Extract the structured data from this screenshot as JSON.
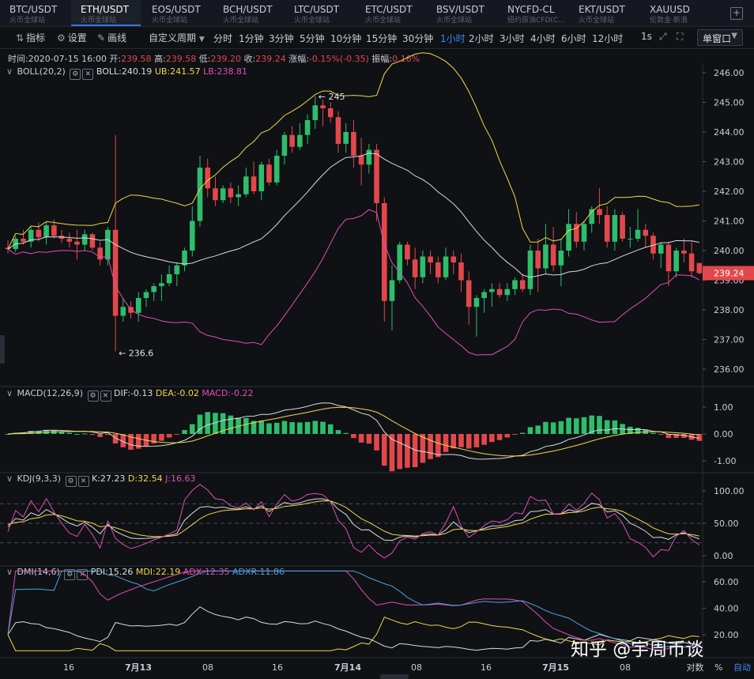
{
  "tabs": [
    {
      "symbol": "BTC/USDT",
      "source": "火币全球站",
      "active": false
    },
    {
      "symbol": "ETH/USDT",
      "source": "火币全球站",
      "active": true
    },
    {
      "symbol": "EOS/USDT",
      "source": "火币全球站",
      "active": false
    },
    {
      "symbol": "BCH/USDT",
      "source": "火币全球站",
      "active": false
    },
    {
      "symbol": "LTC/USDT",
      "source": "火币全球站",
      "active": false
    },
    {
      "symbol": "ETC/USDT",
      "source": "火币全球站",
      "active": false
    },
    {
      "symbol": "BSV/USDT",
      "source": "火币全球站",
      "active": false
    },
    {
      "symbol": "NYCFD-CL",
      "source": "纽约原油CFD(C...",
      "active": false
    },
    {
      "symbol": "EKT/USDT",
      "source": "火币全球站",
      "active": false
    },
    {
      "symbol": "XAUUSD",
      "source": "伦敦金·新浪",
      "active": false
    }
  ],
  "toolbar": {
    "indicators": "指标",
    "settings": "设置",
    "draw": "画线",
    "custom_period": "自定义周期",
    "periods": [
      "分时",
      "1分钟",
      "3分钟",
      "5分钟",
      "10分钟",
      "15分钟",
      "30分钟",
      "1小时",
      "2小时",
      "3小时",
      "4小时",
      "6小时",
      "12小时"
    ],
    "active_period": "1小时",
    "interval": "1s",
    "window_mode": "单窗口"
  },
  "info": {
    "time_label": "时间:",
    "time": "2020-07-15 16:00",
    "open_label": "开:",
    "open": "239.58",
    "high_label": "高:",
    "high": "239.58",
    "low_label": "低:",
    "low": "239.20",
    "close_label": "收:",
    "close": "239.24",
    "change_label": "涨幅:",
    "change": "-0.15%(-0.35)",
    "amp_label": "振幅:",
    "amp": "0.16%"
  },
  "boll": {
    "title": "BOLL(20,2)",
    "mid": "BOLL:240.19",
    "ub": "UB:241.57",
    "lb": "LB:238.81",
    "max_label": "245",
    "min_label": "236.6",
    "y_ticks": [
      "246.00",
      "245.00",
      "244.00",
      "243.00",
      "242.00",
      "241.00",
      "240.00",
      "239.00",
      "238.00",
      "237.00",
      "236.00"
    ],
    "price_tag": "239.24"
  },
  "macd": {
    "title": "MACD(12,26,9)",
    "dif": "DIF:-0.13",
    "dea": "DEA:-0.02",
    "macd": "MACD:-0.22",
    "y_ticks": [
      "1.00",
      "0.00",
      "-1.00"
    ]
  },
  "kdj": {
    "title": "KDJ(9,3,3)",
    "k": "K:27.23",
    "d": "D:32.54",
    "j": "J:16.63",
    "y_ticks": [
      "100.00",
      "50.00",
      "0.00"
    ]
  },
  "dmi": {
    "title": "DMI(14,6)",
    "pdi": "PDI:15.26",
    "mdi": "MDI:22.19",
    "adx": "ADX:12.35",
    "adxr": "ADXR:11.86",
    "y_ticks": [
      "60.00",
      "40.00",
      "20.00"
    ]
  },
  "x_axis": [
    "16",
    "7月13",
    "08",
    "16",
    "7月14",
    "08",
    "16",
    "7月15",
    "08"
  ],
  "bottom": {
    "log": "对数",
    "percent": "%",
    "auto": "自动"
  },
  "watermark": "知乎 @宇周币谈",
  "colors": {
    "up": "#2ebd6b",
    "down": "#e2484b",
    "ub": "#f2d84a",
    "mid": "#d9dbdf",
    "lb": "#e04fb4",
    "accent": "#3d8af7",
    "adx": "#4aa3df"
  },
  "chart_data": {
    "type": "candlestick",
    "interval": "1h",
    "candles": [
      [
        240.1,
        240.35,
        239.9,
        240.05
      ],
      [
        240.05,
        240.5,
        239.95,
        240.4
      ],
      [
        240.4,
        240.7,
        240.2,
        240.3
      ],
      [
        240.3,
        240.8,
        240.1,
        240.7
      ],
      [
        240.7,
        240.95,
        240.3,
        240.45
      ],
      [
        240.45,
        240.95,
        240.2,
        240.85
      ],
      [
        240.85,
        241.05,
        240.4,
        240.5
      ],
      [
        240.5,
        240.7,
        240.25,
        240.4
      ],
      [
        240.4,
        240.6,
        240.1,
        240.3
      ],
      [
        240.3,
        240.7,
        239.7,
        240.2
      ],
      [
        240.2,
        240.7,
        240.0,
        240.55
      ],
      [
        240.55,
        240.6,
        240.0,
        240.1
      ],
      [
        240.1,
        240.3,
        239.5,
        239.7
      ],
      [
        239.7,
        240.8,
        239.5,
        240.7
      ],
      [
        240.7,
        243.9,
        236.6,
        237.8
      ],
      [
        237.8,
        238.4,
        237.6,
        238.1
      ],
      [
        238.1,
        238.3,
        237.7,
        237.9
      ],
      [
        237.9,
        238.6,
        237.6,
        238.4
      ],
      [
        238.4,
        238.7,
        238.1,
        238.6
      ],
      [
        238.6,
        238.9,
        238.3,
        238.8
      ],
      [
        238.8,
        239.2,
        238.3,
        238.9
      ],
      [
        238.9,
        239.5,
        238.8,
        239.2
      ],
      [
        239.2,
        239.6,
        238.8,
        239.5
      ],
      [
        239.5,
        240.1,
        239.3,
        240.0
      ],
      [
        240.0,
        241.5,
        239.8,
        241.0
      ],
      [
        241.0,
        243.2,
        240.8,
        242.8
      ],
      [
        242.8,
        243.1,
        241.8,
        242.1
      ],
      [
        242.1,
        242.5,
        241.5,
        241.7
      ],
      [
        241.7,
        242.2,
        241.6,
        242.1
      ],
      [
        242.1,
        242.3,
        241.6,
        241.8
      ],
      [
        241.8,
        242.2,
        241.5,
        241.9
      ],
      [
        241.9,
        242.8,
        241.8,
        242.5
      ],
      [
        242.5,
        243.0,
        241.9,
        242.0
      ],
      [
        242.0,
        243.0,
        241.7,
        242.9
      ],
      [
        242.9,
        243.1,
        242.2,
        242.3
      ],
      [
        242.3,
        243.4,
        242.2,
        243.2
      ],
      [
        243.2,
        244.0,
        242.9,
        243.9
      ],
      [
        243.9,
        244.2,
        243.3,
        243.5
      ],
      [
        243.5,
        244.3,
        243.4,
        243.9
      ],
      [
        243.9,
        244.6,
        243.6,
        244.4
      ],
      [
        244.4,
        245.2,
        244.1,
        244.9
      ],
      [
        244.9,
        245.1,
        244.2,
        244.8
      ],
      [
        244.8,
        245.0,
        244.3,
        244.5
      ],
      [
        244.5,
        244.7,
        243.3,
        243.6
      ],
      [
        243.6,
        244.3,
        243.3,
        244.0
      ],
      [
        244.0,
        244.4,
        242.8,
        243.2
      ],
      [
        243.2,
        243.8,
        242.2,
        242.9
      ],
      [
        242.9,
        243.6,
        242.6,
        243.4
      ],
      [
        243.4,
        243.6,
        241.0,
        241.6
      ],
      [
        241.6,
        241.8,
        237.6,
        238.3
      ],
      [
        238.3,
        239.5,
        237.3,
        239.0
      ],
      [
        239.0,
        240.3,
        238.9,
        240.2
      ],
      [
        240.2,
        240.3,
        239.5,
        239.7
      ],
      [
        239.7,
        240.1,
        238.7,
        239.1
      ],
      [
        239.1,
        240.0,
        238.9,
        239.8
      ],
      [
        239.8,
        240.0,
        239.2,
        239.6
      ],
      [
        239.6,
        239.8,
        238.9,
        239.1
      ],
      [
        239.1,
        240.1,
        239.0,
        239.8
      ],
      [
        239.8,
        240.0,
        239.2,
        239.6
      ],
      [
        239.6,
        239.9,
        238.6,
        239.0
      ],
      [
        239.0,
        239.3,
        237.5,
        238.1
      ],
      [
        238.1,
        238.5,
        237.1,
        238.4
      ],
      [
        238.4,
        238.7,
        237.9,
        238.6
      ],
      [
        238.6,
        238.9,
        238.1,
        238.7
      ],
      [
        238.7,
        238.9,
        238.4,
        238.5
      ],
      [
        238.5,
        238.9,
        238.3,
        238.7
      ],
      [
        238.7,
        239.1,
        238.5,
        239.0
      ],
      [
        239.0,
        239.2,
        238.6,
        238.7
      ],
      [
        238.7,
        240.2,
        238.5,
        240.0
      ],
      [
        240.0,
        240.4,
        238.6,
        239.4
      ],
      [
        239.4,
        240.9,
        239.2,
        240.2
      ],
      [
        240.2,
        240.8,
        239.3,
        239.5
      ],
      [
        239.5,
        240.4,
        238.8,
        240.0
      ],
      [
        240.0,
        241.4,
        239.8,
        240.9
      ],
      [
        240.9,
        241.3,
        240.1,
        240.3
      ],
      [
        240.3,
        241.0,
        240.0,
        240.9
      ],
      [
        240.9,
        241.5,
        240.6,
        241.4
      ],
      [
        241.4,
        242.1,
        240.9,
        241.2
      ],
      [
        241.2,
        241.5,
        240.1,
        240.3
      ],
      [
        240.3,
        241.4,
        240.0,
        241.2
      ],
      [
        241.2,
        241.3,
        240.3,
        240.4
      ],
      [
        240.4,
        240.8,
        240.1,
        240.4
      ],
      [
        240.4,
        241.4,
        240.3,
        240.7
      ],
      [
        240.7,
        240.9,
        240.1,
        240.5
      ],
      [
        240.5,
        240.6,
        239.7,
        239.9
      ],
      [
        239.9,
        240.3,
        239.4,
        240.2
      ],
      [
        240.2,
        240.3,
        238.8,
        239.3
      ],
      [
        239.3,
        240.1,
        239.1,
        240.0
      ],
      [
        240.0,
        240.4,
        239.6,
        239.9
      ],
      [
        239.9,
        240.3,
        239.1,
        239.3
      ],
      [
        239.58,
        239.58,
        239.2,
        239.24
      ]
    ],
    "price_axis": {
      "min": 236.0,
      "max": 246.0
    },
    "max_marker": 245,
    "min_marker": 236.6
  }
}
